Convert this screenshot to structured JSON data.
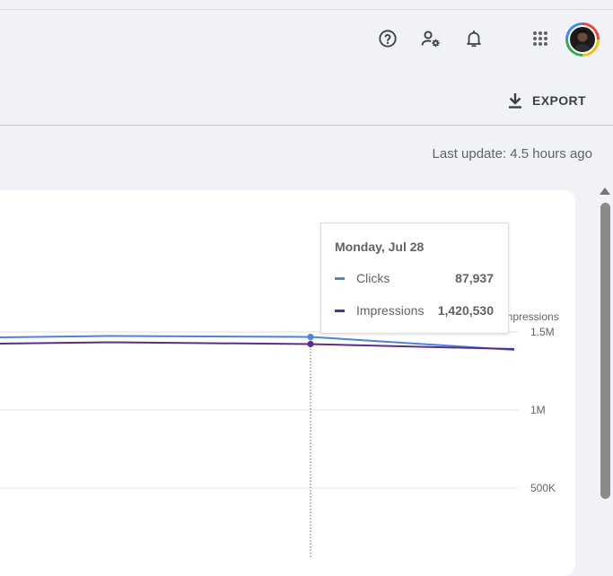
{
  "header": {
    "icons": [
      "help-icon",
      "manage-users-icon",
      "notifications-icon",
      "apps-grid-icon"
    ],
    "avatar": "account-avatar"
  },
  "toolbar": {
    "export_label": "EXPORT"
  },
  "status": {
    "last_update": "Last update: 4.5 hours ago"
  },
  "tooltip": {
    "date": "Monday, Jul 28",
    "rows": [
      {
        "label": "Clicks",
        "value": "87,937",
        "color": "#4a85d8"
      },
      {
        "label": "Impressions",
        "value": "1,420,530",
        "color": "#5b2c8e"
      }
    ]
  },
  "chart_data": {
    "type": "line",
    "right_axis_title": "Impressions",
    "right_ticks": [
      "1.5M",
      "1M",
      "500K"
    ],
    "series": [
      {
        "name": "Clicks",
        "color": "#4a85d8"
      },
      {
        "name": "Impressions",
        "color": "#5b2c8e"
      }
    ],
    "highlighted_point": "Monday, Jul 28"
  }
}
